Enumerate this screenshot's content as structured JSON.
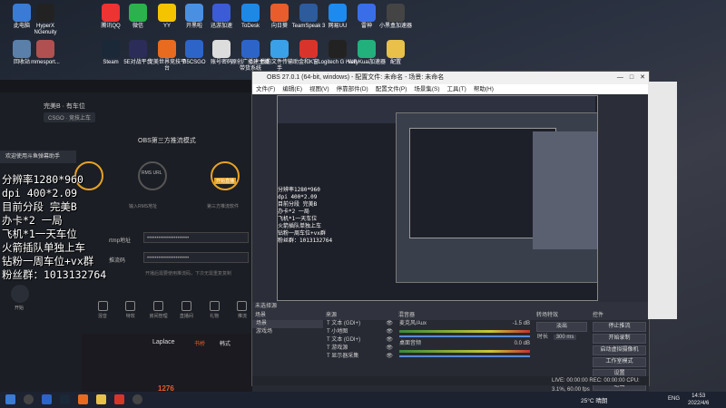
{
  "desktop_icons": [
    {
      "label": "此电脑",
      "icon": "computer-icon",
      "color": "#3a7bd5"
    },
    {
      "label": "HyperX NGenuity",
      "icon": "hyperx-icon",
      "color": "#222"
    },
    {
      "label": "腾讯QQ",
      "icon": "qq-icon",
      "color": "#e33"
    },
    {
      "label": "微信",
      "icon": "wechat-icon",
      "color": "#2bb24c"
    },
    {
      "label": "YY",
      "icon": "yy-icon",
      "color": "#f5c400"
    },
    {
      "label": "开黑啦",
      "icon": "kaiheila-icon",
      "color": "#4a90e2"
    },
    {
      "label": "迅游加速",
      "icon": "xunyou-icon",
      "color": "#3b5cd6"
    },
    {
      "label": "ToDesk",
      "icon": "todesk-icon",
      "color": "#1e88e5"
    },
    {
      "label": "向日葵",
      "icon": "sunflower-icon",
      "color": "#e85d2b"
    },
    {
      "label": "TeamSpeak 3",
      "icon": "teamspeak-icon",
      "color": "#2d5b9c"
    },
    {
      "label": "网易UU",
      "icon": "uu-icon",
      "color": "#1d8af0"
    },
    {
      "label": "雷神",
      "icon": "leishen-icon",
      "color": "#3a6ee8"
    },
    {
      "label": "小黑盒加速器",
      "icon": "heybox-icon",
      "color": "#444"
    }
  ],
  "desktop_icons_row2": [
    {
      "label": "回收站",
      "icon": "recycle-bin-icon",
      "color": "#5a7fa8"
    },
    {
      "label": "mmesport...",
      "icon": "mmesport-icon",
      "color": "#b05050"
    },
    {
      "label": "Steam",
      "icon": "steam-icon",
      "color": "#1b2838"
    },
    {
      "label": "5E对战平台",
      "icon": "5e-icon",
      "color": "#2c2c58"
    },
    {
      "label": "完美世界竞技平台",
      "icon": "perfect-world-icon",
      "color": "#e86b1f"
    },
    {
      "label": "B5CSGO",
      "icon": "b5-icon",
      "color": "#2d64c8"
    },
    {
      "label": "账号密码",
      "icon": "document-icon",
      "color": "#ddd"
    },
    {
      "label": "原创广播建主播带货系统",
      "icon": "broadcast-icon",
      "color": "#2d64c8"
    },
    {
      "label": "我的文件传输助手",
      "icon": "file-transfer-icon",
      "color": "#3aa0e8"
    },
    {
      "label": "金和K窗",
      "icon": "window-icon",
      "color": "#d9342b"
    },
    {
      "label": "Logitech G HUB",
      "icon": "logitech-icon",
      "color": "#222"
    },
    {
      "label": "VeryKuai加速器",
      "icon": "verykuai-icon",
      "color": "#22b07d"
    },
    {
      "label": "配置",
      "icon": "folder-icon",
      "color": "#e8c04a"
    }
  ],
  "stream_app": {
    "breadcrumb": "完美B · 有车位",
    "category": "CSGO · 竞技上车",
    "third_party_title": "OBS第三方推流模式",
    "rtmp_label": "rtmp地址",
    "key_label": "推流码",
    "masked_value": "••••••••••••••••••••••",
    "hint": "开播后需要使用推流码，下次无需重复复制",
    "help_text": "欢迎使用斗鱼弹幕助手",
    "steps": [
      {
        "title": "RMS URL",
        "desc": "输入RMS地址"
      },
      {
        "title": "开始直播",
        "desc": "第三方推流软件"
      }
    ],
    "bottom_tools": [
      "混音",
      "特效",
      "房间管理",
      "直播间",
      "礼物",
      "推流"
    ],
    "start_button": "开始"
  },
  "overlay_lines": [
    "分辨率1280*960",
    "dpi 400*2.09",
    "目前分段 完美B",
    "办卡*2 一局",
    "飞机*1一天车位",
    "火箭插队单独上车",
    "钻粉一周车位+vx群",
    "粉丝群：1013132764"
  ],
  "obs": {
    "title": "OBS 27.0.1 (64-bit, windows) - 配置文件: 未命名 - 场景: 未命名",
    "menu": [
      "文件(F)",
      "编辑(E)",
      "视图(V)",
      "停靠部件(D)",
      "配置文件(P)",
      "场景集(S)",
      "工具(T)",
      "帮助(H)"
    ],
    "scenes_header": "场景",
    "scenes": [
      "场景",
      "游戏场"
    ],
    "sources_header": "来源",
    "sources": [
      "文本 (GDI+)",
      "小地图",
      "文本 (GDI+)",
      "游戏源",
      "显示器采集"
    ],
    "mixer_header": "混音器",
    "mixer": [
      {
        "name": "麦克风/Aux",
        "db": "-1.5 dB"
      },
      {
        "name": "桌面音频",
        "db": "0.0 dB"
      }
    ],
    "transition_header": "转场特效",
    "transition_type": "淡出",
    "transition_duration_label": "时长",
    "transition_duration": "300 ms",
    "controls_header": "控件",
    "controls": [
      "停止推流",
      "开始录制",
      "启动虚拟摄像机",
      "工作室模式",
      "设置",
      "退出"
    ],
    "status": "LIVE: 00:00:00   REC: 00:00:00   CPU: 3.1%, 60.00 fps",
    "dock_title": "未选择源"
  },
  "game_panel": {
    "name": "Laplace",
    "stats": [
      "1276",
      "1276"
    ],
    "labels": [
      "书桥",
      "韩式"
    ]
  },
  "taskbar": {
    "weather": "25°C 晴朗",
    "lang": "ENG",
    "time": "14:53",
    "date": "2022/4/6"
  }
}
